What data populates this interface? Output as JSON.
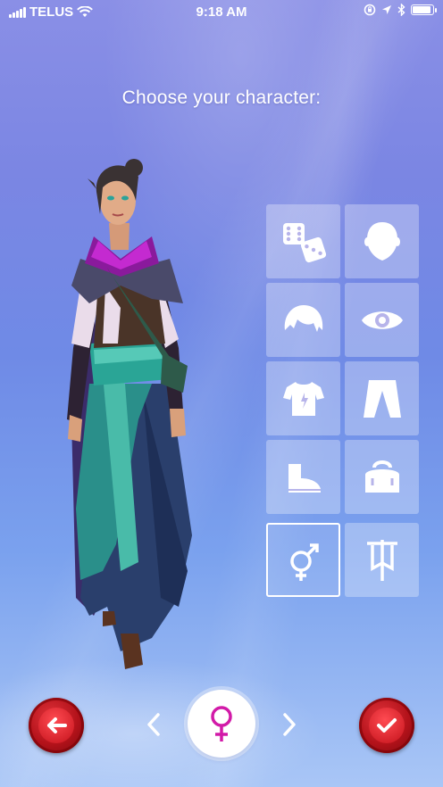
{
  "status_bar": {
    "carrier": "TELUS",
    "time": "9:18 AM",
    "battery_percent": 90
  },
  "title": "Choose your character:",
  "grid": {
    "items": [
      {
        "icon": "dice-icon",
        "action": "randomize"
      },
      {
        "icon": "head-icon",
        "action": "face"
      },
      {
        "icon": "hair-icon",
        "action": "hair"
      },
      {
        "icon": "eye-icon",
        "action": "eyes"
      },
      {
        "icon": "shirt-icon",
        "action": "top"
      },
      {
        "icon": "pants-icon",
        "action": "bottom"
      },
      {
        "icon": "boot-icon",
        "action": "shoes"
      },
      {
        "icon": "bag-icon",
        "action": "accessory"
      },
      {
        "icon": "gender-icon",
        "action": "gender",
        "selected": true
      },
      {
        "icon": "banner-icon",
        "action": "banner"
      }
    ]
  },
  "bottom_bar": {
    "back_icon": "back-arrow-icon",
    "prev_icon": "chevron-left-icon",
    "selected_gender_icon": "female-symbol-icon",
    "next_icon": "chevron-right-icon",
    "confirm_icon": "checkmark-icon"
  },
  "colors": {
    "accent_magenta": "#d21aa8",
    "button_red": "#c4121b",
    "background_top": "#8a8fe6",
    "background_bottom": "#a9c6f6"
  }
}
